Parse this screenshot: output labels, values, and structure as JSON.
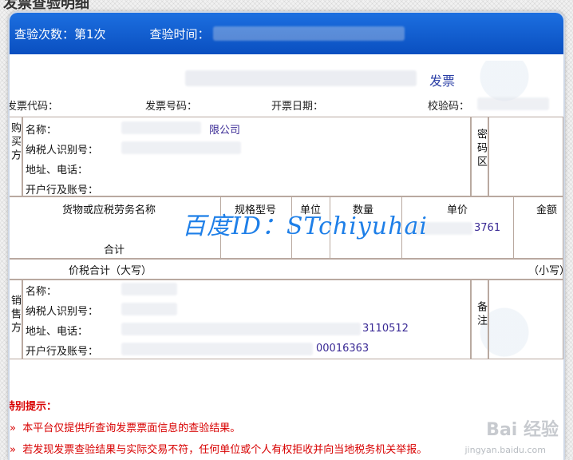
{
  "page": {
    "title": "发票查验明细"
  },
  "header": {
    "check_count": "查验次数：第1次",
    "check_time_label": "查验时间："
  },
  "invoice": {
    "title": "发票",
    "meta": {
      "code_label": "发票代码：",
      "number_label": "发票号码：",
      "date_label": "开票日期：",
      "verify_label": "校验码："
    },
    "buyer": {
      "side_label": "购买方",
      "name_label": "名称：",
      "name_value": "限公司",
      "tax_id_label": "纳税人识别号：",
      "address_label": "地址、电话：",
      "bank_label": "开户行及账号：",
      "cipher_label": "密码区"
    },
    "items": {
      "col_goods": "货物或应税劳务名称",
      "col_spec": "规格型号",
      "col_unit": "单位",
      "col_qty": "数量",
      "col_price": "单价",
      "col_amount": "金额",
      "price_value": "3761",
      "total_label": "合计"
    },
    "tax_total": {
      "label": "价税合计（大写）",
      "lower_label": "（小写）"
    },
    "seller": {
      "side_label": "销售方",
      "name_label": "名称：",
      "tax_id_label": "纳税人识别号：",
      "address_label": "地址、电话：",
      "address_value": "3110512",
      "bank_label": "开户行及账号：",
      "bank_value": "00016363",
      "remark_label": "备注"
    }
  },
  "notice": {
    "title": "特别提示：",
    "items": [
      "本平台仅提供所查询发票票面信息的查验结果。",
      "若发现发票查验结果与实际交易不符，任何单位或个人有权拒收并向当地税务机关举报。"
    ]
  },
  "overlay": {
    "watermark": "百度ID：STchiyuhai",
    "baidu_logo": "Bai 经验",
    "baidu_url": "jingyan.baidu.com"
  }
}
